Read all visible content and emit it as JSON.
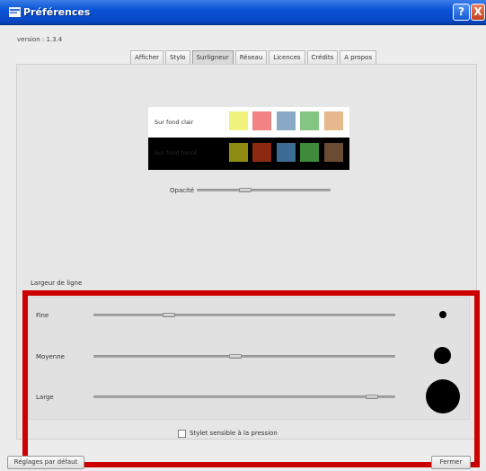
{
  "window": {
    "title": "Préférences",
    "help_glyph": "?",
    "close_glyph": "X",
    "titlebar_color": "#0a52d4",
    "icon": "app-icon"
  },
  "version_text": "version : 1.3.4",
  "tabs": [
    {
      "label": "Afficher",
      "active": false
    },
    {
      "label": "Stylo",
      "active": false
    },
    {
      "label": "Surligneur",
      "active": true
    },
    {
      "label": "Réseau",
      "active": false
    },
    {
      "label": "Licences",
      "active": false
    },
    {
      "label": "Crédits",
      "active": false
    },
    {
      "label": "A propos",
      "active": false
    }
  ],
  "highlighter": {
    "light_label": "Sur fond clair",
    "dark_label": "Sur fond foncé",
    "light_colors": [
      "#f0f47e",
      "#f18384",
      "#8aa9c6",
      "#85c583",
      "#e7b88b"
    ],
    "dark_colors": [
      "#8e8c10",
      "#8b2a11",
      "#3c6c93",
      "#3d8b3b",
      "#6b4b32"
    ],
    "opacity_label": "Opacité",
    "opacity_value": 0.35
  },
  "line_width": {
    "title": "Largeur de ligne",
    "rows": [
      {
        "label": "Fine",
        "value": 0.24
      },
      {
        "label": "Moyenne",
        "value": 0.47
      },
      {
        "label": "Large",
        "value": 0.94
      }
    ]
  },
  "pressure_label": "Stylet sensible à la pression",
  "pressure_checked": false,
  "buttons": {
    "defaults": "Réglages par défaut",
    "close": "Fermer"
  },
  "highlight_box_color": "#cc0000"
}
